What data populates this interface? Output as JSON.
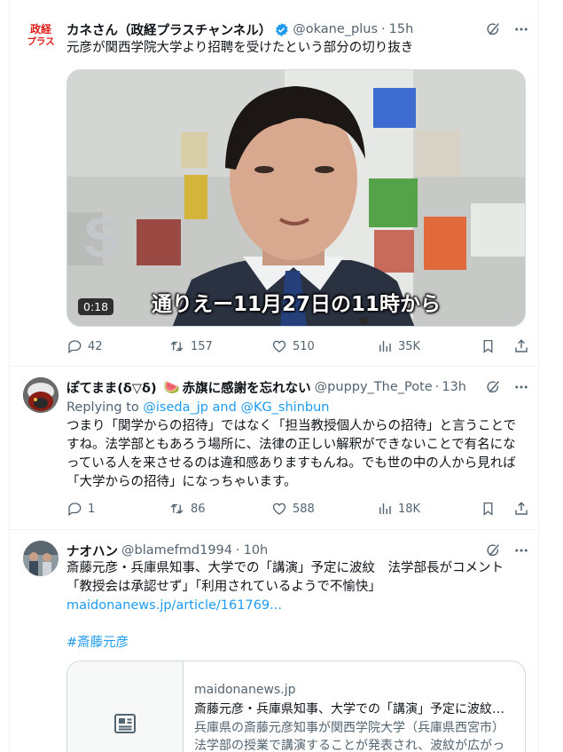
{
  "tweets": [
    {
      "name": "カネさん（政経プラスチャンネル）",
      "handle": "@okane_plus",
      "separator": "·",
      "time": "15h",
      "avatar_text_1": "政経",
      "avatar_text_2": "プラス",
      "text": "元彦が関西学院大学より招聘を受けたという部分の切り抜き",
      "video_duration": "0:18",
      "video_subtitle": "通りえー11月27日の11時から",
      "replies": "42",
      "reposts": "157",
      "likes": "510",
      "views": "35K"
    },
    {
      "name": "ぽてまま(δ▽δ)",
      "name_emoji": "🍉",
      "name_suffix": "赤旗に感謝を忘れない",
      "handle": "@puppy_The_Pote",
      "separator": "·",
      "time": "13h",
      "replying_prefix": "Replying to",
      "replying_user1": "@iseda_jp",
      "replying_and": "and",
      "replying_user2": "@KG_shinbun",
      "text": "つまり「関学からの招待」ではなく「担当教授個人からの招待」と言うことですね。法学部ともあろう場所に、法律の正しい解釈ができないことで有名になっている人を来させるのは違和感ありますもんね。でも世の中の人から見れば「大学からの招待」になっちゃいます。",
      "replies": "1",
      "reposts": "86",
      "likes": "588",
      "views": "18K"
    },
    {
      "name": "ナオハン",
      "handle": "@blamefmd1994",
      "separator": "·",
      "time": "10h",
      "text_line1": "斎藤元彦・兵庫県知事、大学での「講演」予定に波紋　法学部長がコメント",
      "text_line2": "「教授会は承認せず」「利用されているようで不愉快」",
      "link": "maidonanews.jp/article/161769...",
      "hashtag": "#斎藤元彦",
      "card": {
        "domain": "maidonanews.jp",
        "title": "斎藤元彦・兵庫県知事、大学での「講演」予定に波紋　法学部長がコメント",
        "description": "兵庫県の斎藤元彦知事が関西学院大学（兵庫県西宮市）法学部の授業で講演することが発表され、波紋が広がっています。"
      }
    }
  ],
  "colors": {
    "accent": "#1d9bf0",
    "muted": "#536471",
    "text": "#0f1419",
    "verified": "#1d9bf0"
  }
}
